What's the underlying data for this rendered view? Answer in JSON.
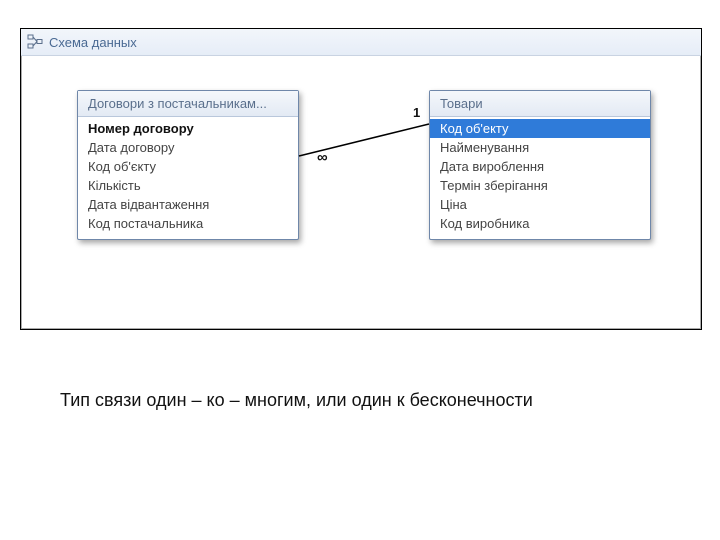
{
  "window": {
    "title": "Схема данных"
  },
  "tables": {
    "left": {
      "title": "Договори з постачальникам...",
      "fields": [
        "Номер договору",
        "Дата договору",
        "Код об'єкту",
        "Кількість",
        "Дата відвантаження",
        "Код постачальника"
      ]
    },
    "right": {
      "title": "Товари",
      "fields": [
        "Код об'екту",
        "Найменування",
        "Дата вироблення",
        "Термін зберігання",
        "Ціна",
        "Код виробника"
      ]
    }
  },
  "relationship": {
    "many_symbol": "∞",
    "one_symbol": "1"
  },
  "caption": "Тип связи один – ко – многим, или один к бесконечности"
}
